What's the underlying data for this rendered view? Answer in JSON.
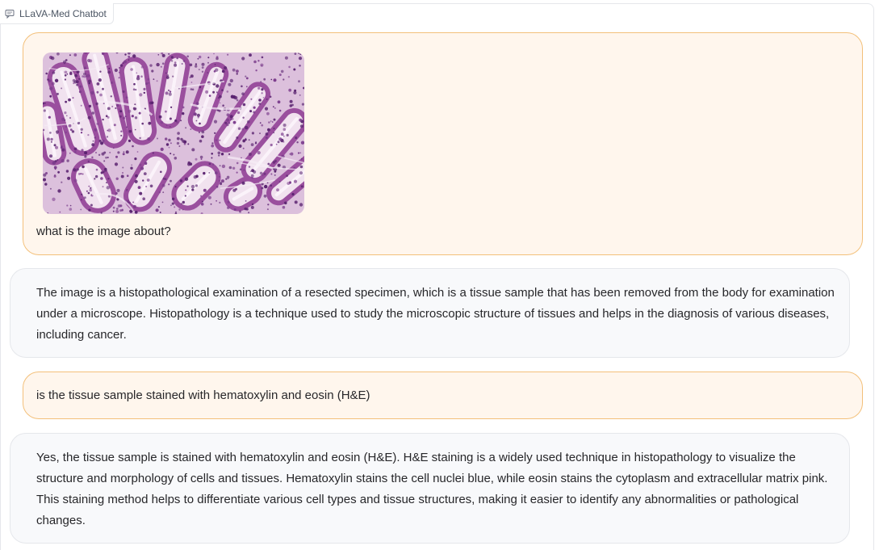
{
  "chatbot": {
    "label": "LLaVA-Med Chatbot",
    "label_icon": "chat-bubble-icon"
  },
  "messages": [
    {
      "role": "user",
      "image": "histology-he-stained-colon-tissue",
      "text": "what is the image about?"
    },
    {
      "role": "assistant",
      "text": "The image is a histopathological examination of a resected specimen, which is a tissue sample that has been removed from the body for examination under a microscope. Histopathology is a technique used to study the microscopic structure of tissues and helps in the diagnosis of various diseases, including cancer."
    },
    {
      "role": "user",
      "text": "is the tissue sample stained with hematoxylin and eosin (H&E)"
    },
    {
      "role": "assistant",
      "text": "Yes, the tissue sample is stained with hematoxylin and eosin (H&E). H&E staining is a widely used technique in histopathology to visualize the structure and morphology of cells and tissues. Hematoxylin stains the cell nuclei blue, while eosin stains the cytoplasm and extracellular matrix pink. This staining method helps to differentiate various cell types and tissue structures, making it easier to identify any abnormalities or pathological changes."
    }
  ],
  "colors": {
    "user_bubble_bg": "#fff6ed",
    "user_bubble_border": "#f3c07a",
    "bot_bubble_bg": "#f8f9fb",
    "stain_pink": "#e2b3d4",
    "stain_purple": "#6b2a7a"
  }
}
